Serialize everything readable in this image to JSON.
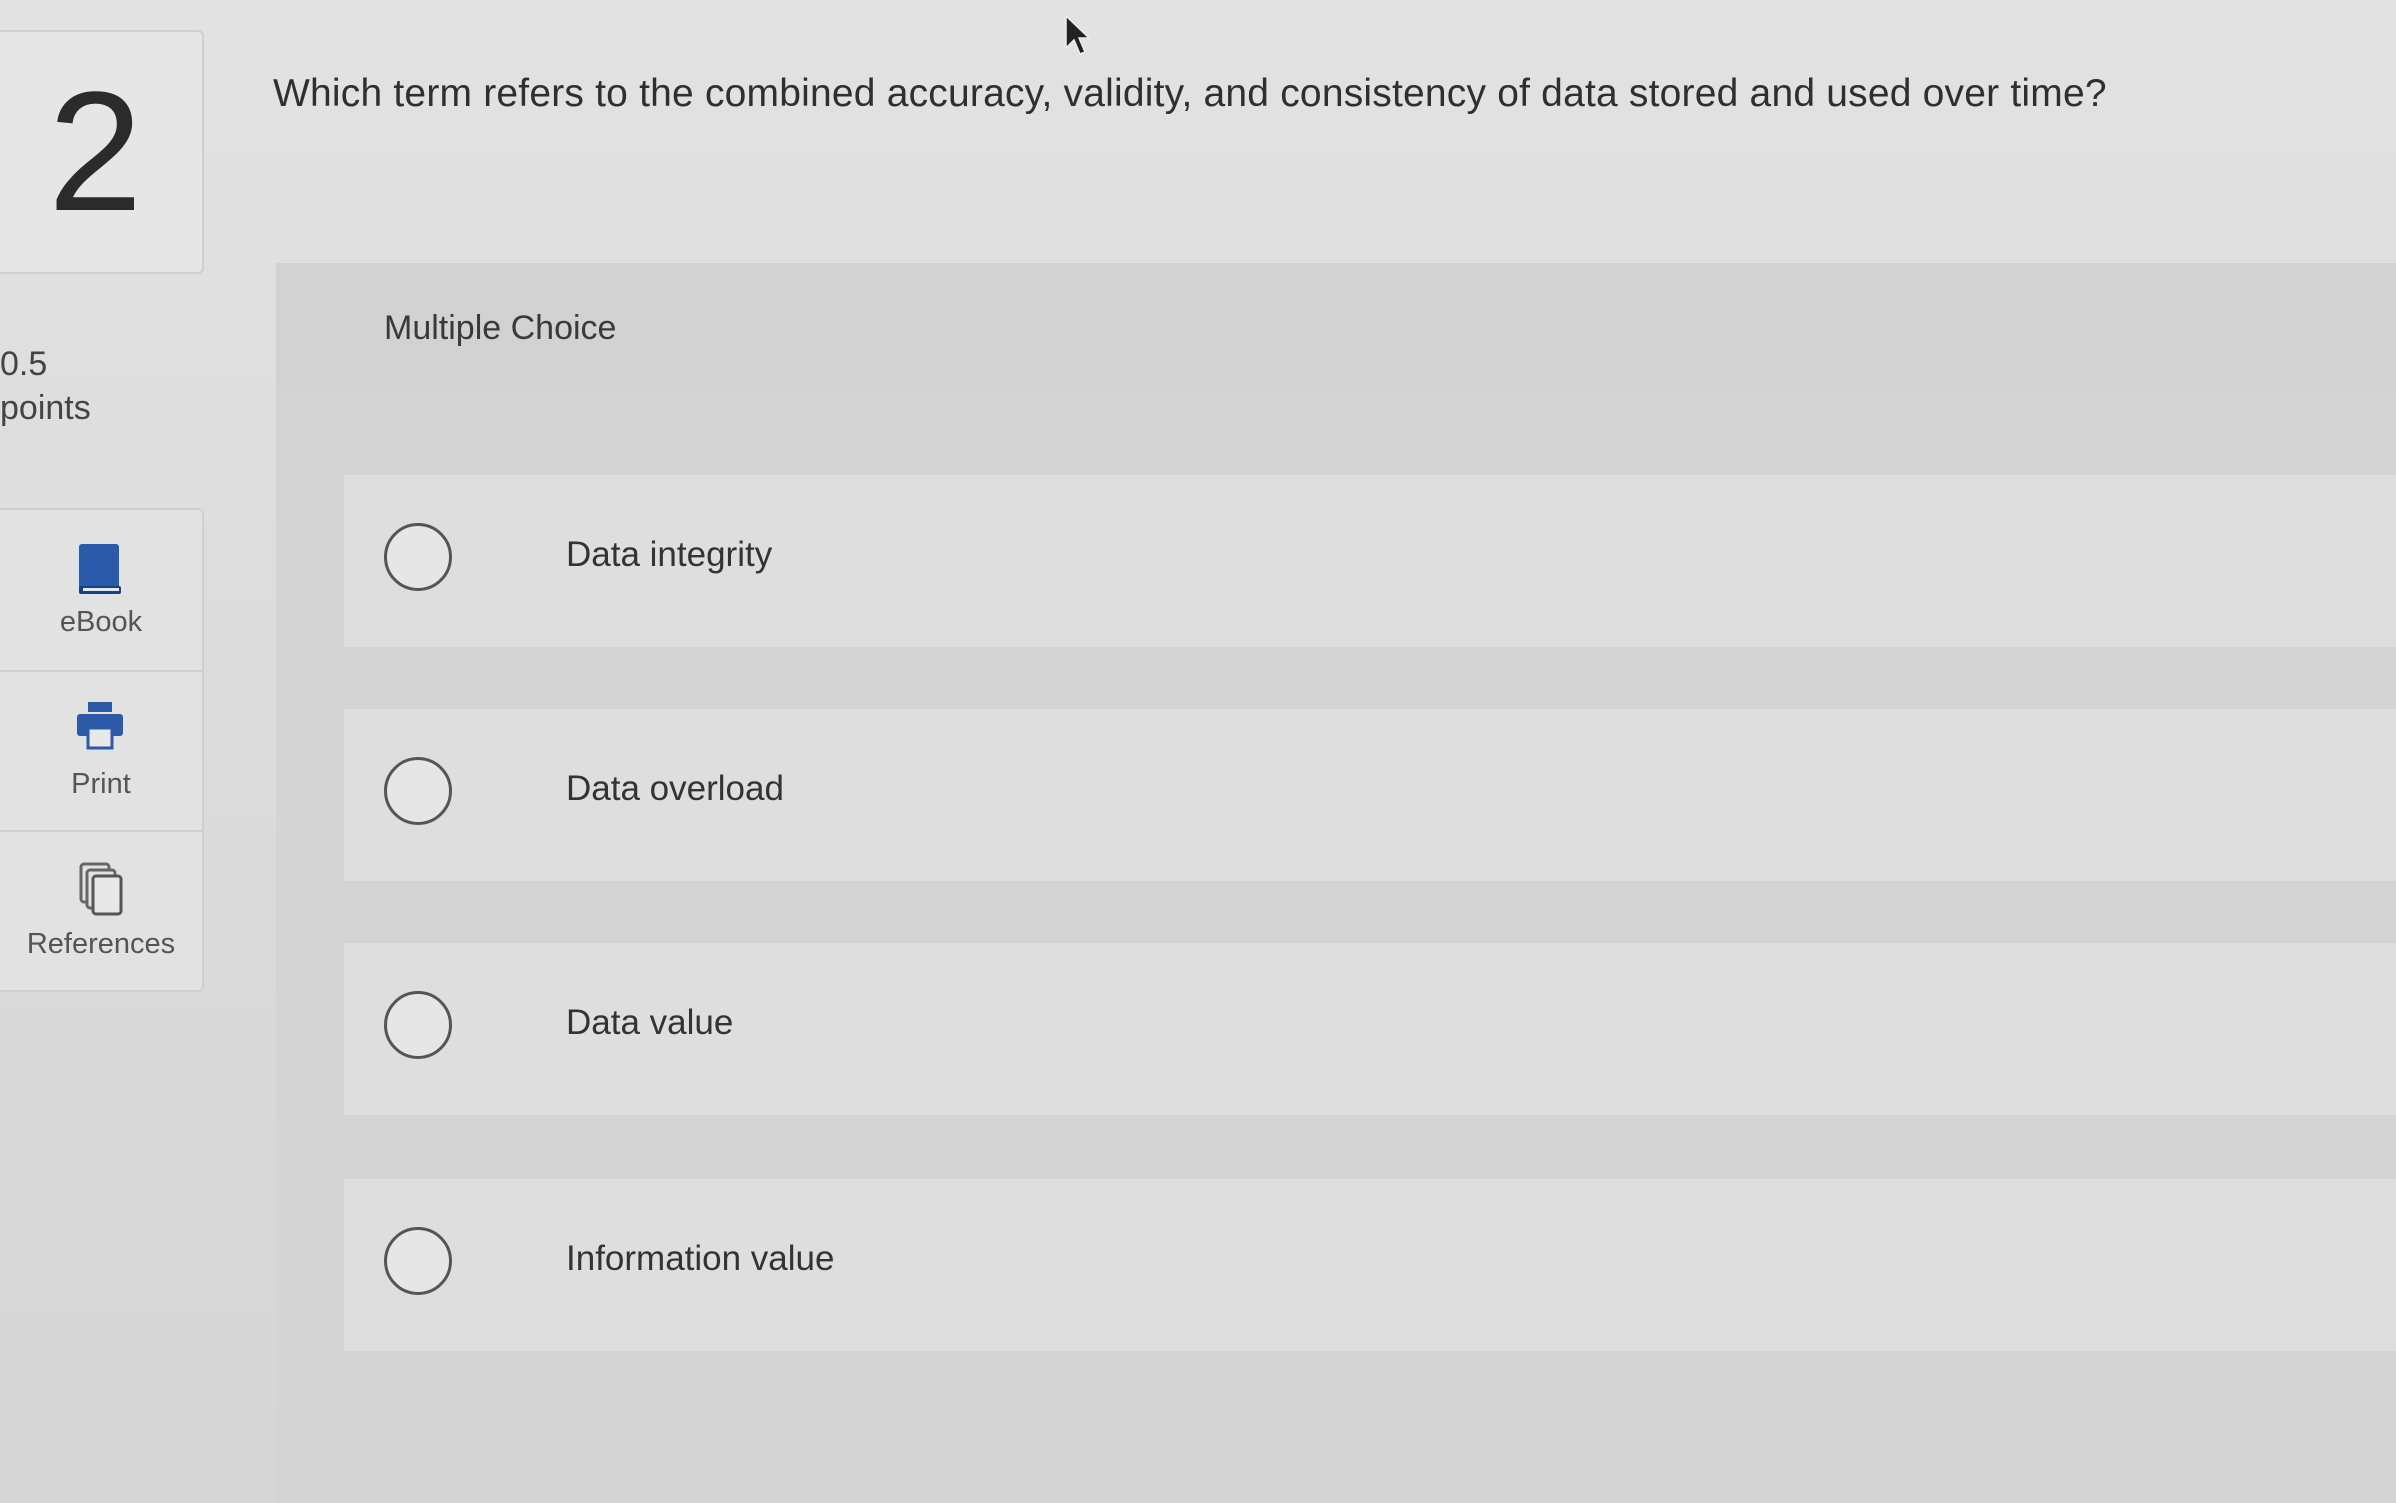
{
  "question": {
    "number": "2",
    "points_value": "0.5",
    "points_label": "points",
    "prompt": "Which term refers to the combined accuracy, validity, and consistency of data stored and used over time?",
    "type_label": "Multiple Choice"
  },
  "tools": [
    {
      "label": "eBook",
      "icon": "book-icon"
    },
    {
      "label": "Print",
      "icon": "printer-icon"
    },
    {
      "label": "References",
      "icon": "documents-icon"
    }
  ],
  "options": [
    {
      "label": "Data integrity",
      "selected": false
    },
    {
      "label": "Data overload",
      "selected": false
    },
    {
      "label": "Data value",
      "selected": false
    },
    {
      "label": "Information value",
      "selected": false
    }
  ],
  "colors": {
    "icon_blue": "#2a5aa8",
    "background": "#dcdcdc"
  }
}
